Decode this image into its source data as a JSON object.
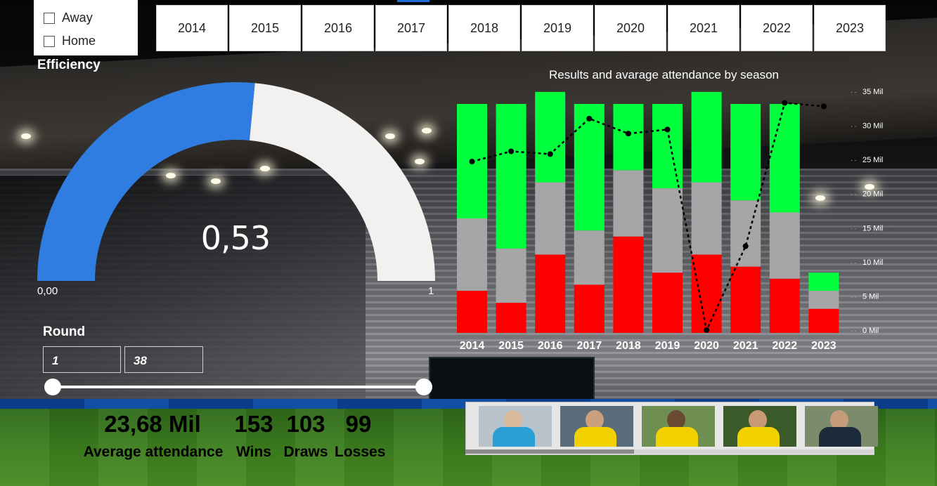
{
  "filters": {
    "venue_options": [
      "Away",
      "Home"
    ],
    "seasons": [
      "2014",
      "2015",
      "2016",
      "2017",
      "2018",
      "2019",
      "2020",
      "2021",
      "2022",
      "2023"
    ]
  },
  "efficiency": {
    "title": "Efficiency",
    "value_label": "0,53",
    "value": 0.53,
    "min_label": "0,00",
    "max_label": "1",
    "fill_color": "#2f7de1",
    "rest_color": "#f2f1f0"
  },
  "round": {
    "title": "Round",
    "from": "1",
    "to": "38"
  },
  "kpis": {
    "attendance_value": "23,68 Mil",
    "attendance_label": "Average attendance",
    "wins_value": "153",
    "wins_label": "Wins",
    "draws_value": "103",
    "draws_label": "Draws",
    "losses_value": "99",
    "losses_label": "Losses"
  },
  "chart_data": {
    "type": "bar",
    "title": "Results and avarage attendance by season",
    "categories": [
      "2014",
      "2015",
      "2016",
      "2017",
      "2018",
      "2019",
      "2020",
      "2021",
      "2022",
      "2023"
    ],
    "series": [
      {
        "values": [
          7,
          5,
          13,
          8,
          16,
          10,
          13,
          11,
          9,
          4
        ],
        "color": "#ff0000"
      },
      {
        "values": [
          12,
          9,
          12,
          9,
          11,
          14,
          12,
          11,
          11,
          3
        ],
        "color": "#a6a6a6"
      },
      {
        "values": [
          19,
          24,
          15,
          21,
          11,
          14,
          15,
          16,
          18,
          3
        ],
        "color": "#00ff3c"
      }
    ],
    "line": {
      "values": [
        24700,
        26200,
        25800,
        31000,
        28800,
        29400,
        0,
        12300,
        33300,
        32800
      ]
    },
    "y2_ticks": [
      "0 Mil",
      "5 Mil",
      "10 Mil",
      "15 Mil",
      "20 Mil",
      "25 Mil",
      "30 Mil",
      "35 Mil"
    ],
    "y2lim": [
      0,
      35000
    ],
    "ylim": [
      0,
      38
    ]
  },
  "referees": {
    "items": [
      "referee-1",
      "referee-2",
      "referee-3",
      "referee-4",
      "referee-5"
    ]
  }
}
